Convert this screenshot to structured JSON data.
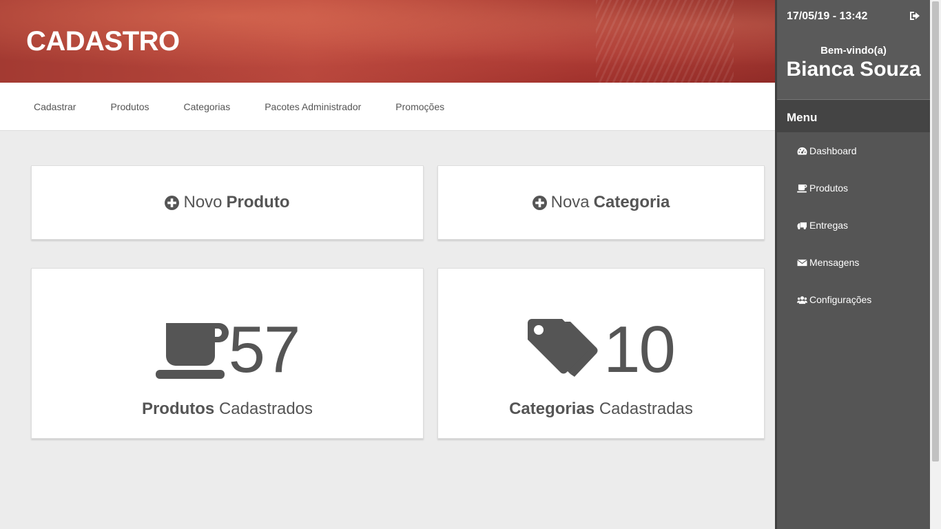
{
  "header": {
    "title": "CADASTRO"
  },
  "topnav": {
    "items": [
      "Cadastrar",
      "Produtos",
      "Categorias",
      "Pacotes Administrador",
      "Promoções"
    ]
  },
  "actions": {
    "new_product": {
      "prefix": "Novo",
      "bold": "Produto",
      "icon": "plus-circle-icon"
    },
    "new_category": {
      "prefix": "Nova",
      "bold": "Categoria",
      "icon": "plus-circle-icon"
    }
  },
  "stats": {
    "products": {
      "count": "57",
      "bold": "Produtos",
      "rest": "Cadastrados",
      "icon": "coffee-cup-icon"
    },
    "categories": {
      "count": "10",
      "bold": "Categorias",
      "rest": "Cadastradas",
      "icon": "tags-icon"
    }
  },
  "sidebar": {
    "datetime": "17/05/19 - 13:42",
    "welcome": "Bem-vindo(a)",
    "user": "Bianca Souza",
    "menu_title": "Menu",
    "items": [
      {
        "label": "Dashboard",
        "icon": "dashboard-icon"
      },
      {
        "label": "Produtos",
        "icon": "coffee-icon"
      },
      {
        "label": "Entregas",
        "icon": "truck-icon"
      },
      {
        "label": "Mensagens",
        "icon": "envelope-icon"
      },
      {
        "label": "Configurações",
        "icon": "users-icon"
      }
    ]
  },
  "colors": {
    "accent": "#a33a32",
    "sidebar": "#555555",
    "text": "#555555"
  }
}
